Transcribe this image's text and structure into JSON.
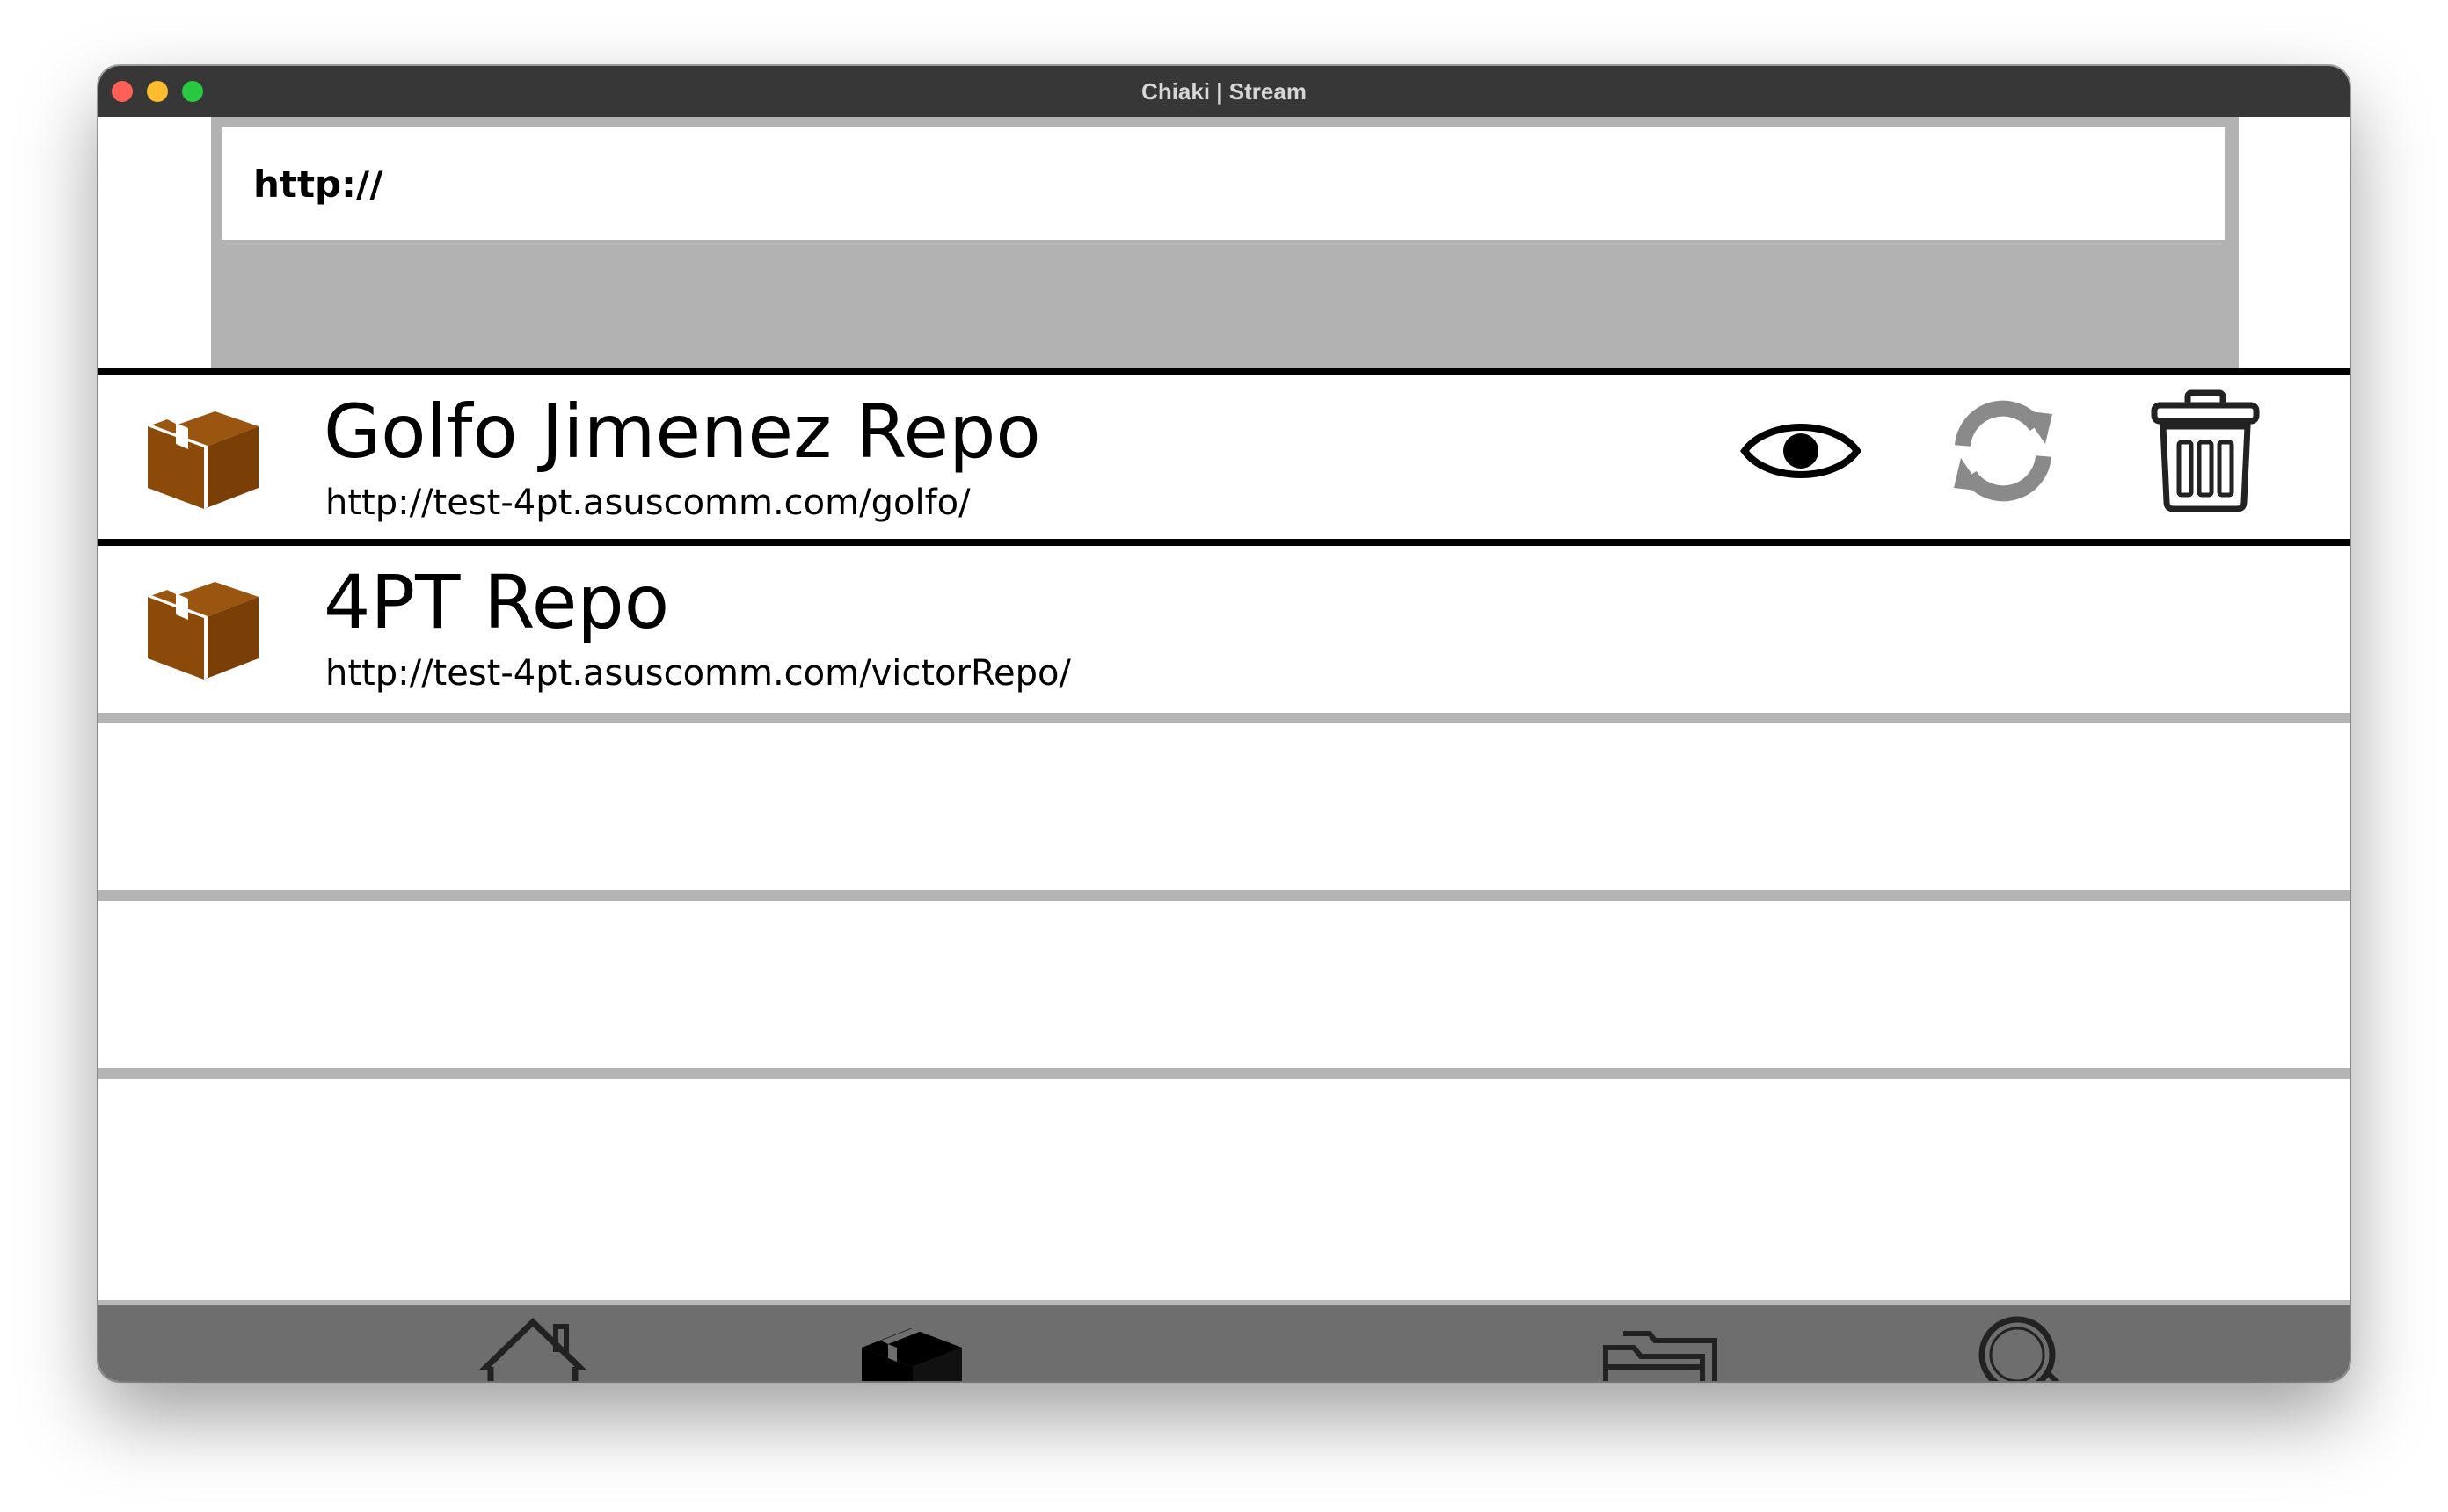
{
  "window": {
    "title": "Chiaki | Stream"
  },
  "url_bar": {
    "value": "http://"
  },
  "repos": [
    {
      "name": "Golfo Jimenez Repo",
      "url": "http://test-4pt.asuscomm.com/golfo/",
      "icon": "package-box-icon",
      "selected": true,
      "actions": [
        "eye-icon",
        "refresh-icon",
        "trash-icon"
      ]
    },
    {
      "name": "4PT Repo",
      "url": "http://test-4pt.asuscomm.com/victorRepo/",
      "icon": "package-box-icon",
      "selected": false
    }
  ],
  "bottom_nav": [
    {
      "icon": "home-icon"
    },
    {
      "icon": "package-icon",
      "active": true
    },
    {
      "icon": "folders-icon"
    },
    {
      "icon": "search-icon"
    }
  ],
  "colors": {
    "titlebar": "#373737",
    "panel_gray": "#b2b2b2",
    "row_divider": "#b4b4b4",
    "bottom_bar": "#6e6e6e",
    "box_brown": "#8b4a09",
    "refresh_gray": "#8a8a8a"
  }
}
